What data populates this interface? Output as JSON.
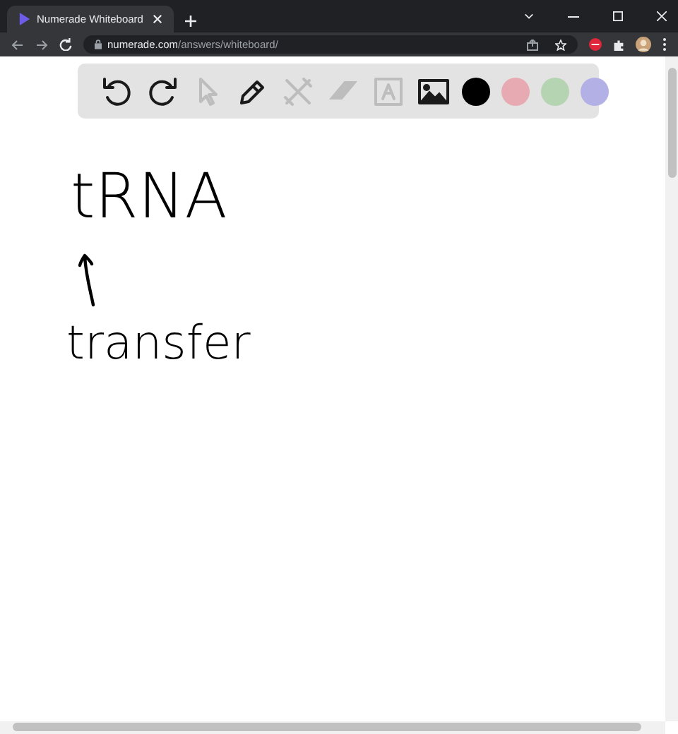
{
  "browser": {
    "tab_title": "Numerade Whiteboard",
    "url_domain": "numerade.com",
    "url_path": "/answers/whiteboard/"
  },
  "toolbar": {
    "tools": [
      {
        "kind": "undo",
        "disabled": false
      },
      {
        "kind": "redo",
        "disabled": false
      },
      {
        "kind": "select",
        "disabled": true
      },
      {
        "kind": "pen",
        "disabled": false
      },
      {
        "kind": "tools",
        "disabled": true
      },
      {
        "kind": "eraser",
        "disabled": true
      },
      {
        "kind": "text",
        "disabled": true
      },
      {
        "kind": "image",
        "disabled": false
      }
    ],
    "colors": [
      {
        "color": "#000000"
      },
      {
        "color": "#e8aab2"
      },
      {
        "color": "#b5d4b2"
      },
      {
        "color": "#b3b0e6"
      }
    ]
  },
  "canvas": {
    "texts": [
      "tRNA",
      "transfer"
    ]
  }
}
